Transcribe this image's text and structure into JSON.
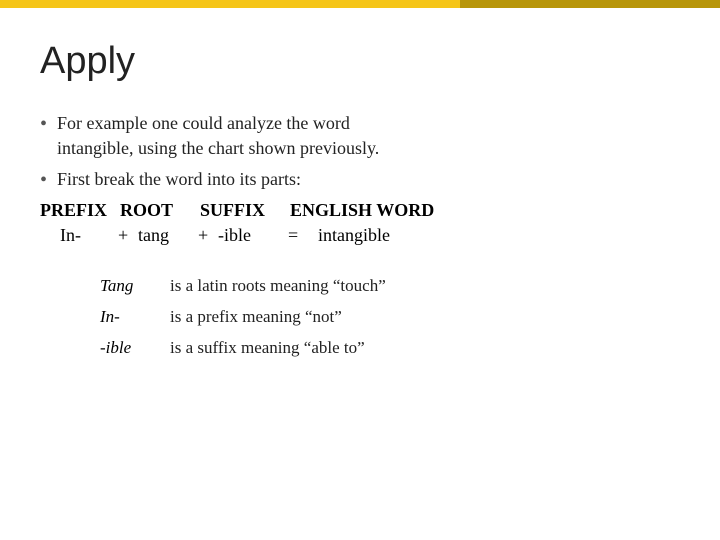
{
  "page": {
    "title": "Apply",
    "accent_colors": {
      "yellow": "#f5c518",
      "dark_gold": "#b8960a"
    }
  },
  "bullets": [
    {
      "text_line1": "For example one could analyze the word",
      "text_line2": "intangible, using the chart shown previously."
    },
    {
      "text_line1": "First break the word into its parts:"
    }
  ],
  "word_parts_header": {
    "col1": "PREFIX",
    "col2": "ROOT",
    "col3": "SUFFIX",
    "col4": "ENGLISH WORD"
  },
  "word_parts_equation": {
    "prefix": "In-",
    "plus1": "+",
    "root": "tang",
    "plus2": "+",
    "suffix": "-ible",
    "equals": "=",
    "result": "intangible"
  },
  "definitions": [
    {
      "term": "Tang",
      "description": "is a latin roots meaning “touch”"
    },
    {
      "term": "In-",
      "description": "is a prefix meaning “not”"
    },
    {
      "term": "-ible",
      "description": "is a suffix meaning “able to”"
    }
  ]
}
